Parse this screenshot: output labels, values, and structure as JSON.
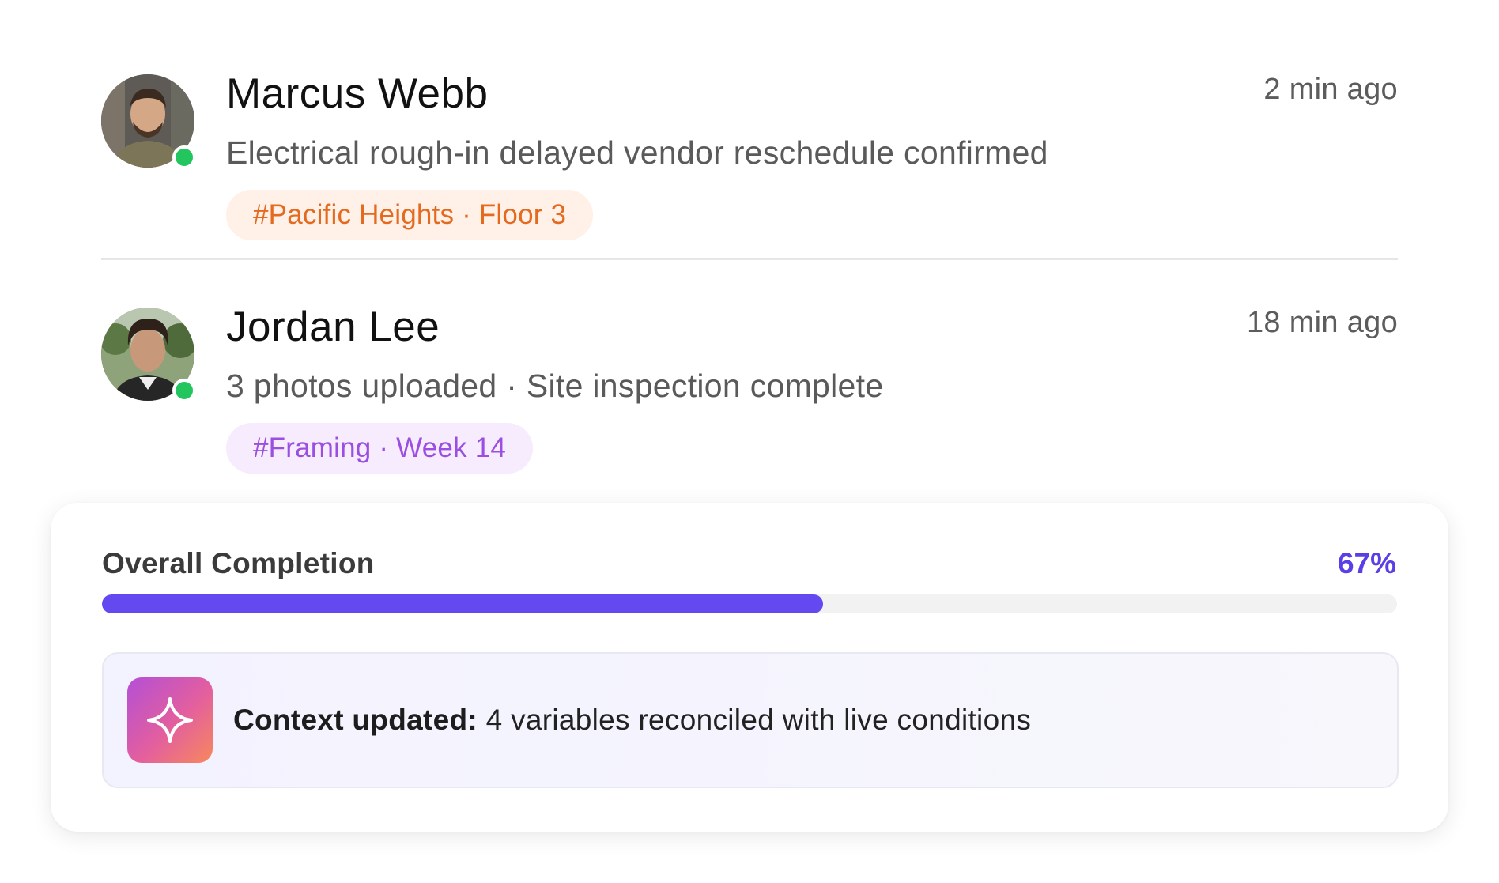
{
  "activities": [
    {
      "name": "Marcus Webb",
      "message": "Electrical rough-in delayed vendor reschedule confirmed",
      "tag": "#Pacific Heights · Floor 3",
      "time": "2 min ago",
      "status": "online",
      "tag_color": "#e46a1f"
    },
    {
      "name": "Jordan Lee",
      "message": "3 photos uploaded · Site inspection complete",
      "tag": "#Framing · Week 14",
      "time": "18 min ago",
      "status": "online",
      "tag_color": "#9b4fe0"
    }
  ],
  "progress": {
    "label": "Overall Completion",
    "value_text": "67%",
    "value": 0.557,
    "accent": "#6549f0"
  },
  "notice": {
    "title": "Context updated:",
    "text": "4 variables reconciled with live conditions",
    "icon": "sparkle-icon"
  },
  "colors": {
    "online": "#22c55e",
    "accent": "#5a3ee6"
  }
}
